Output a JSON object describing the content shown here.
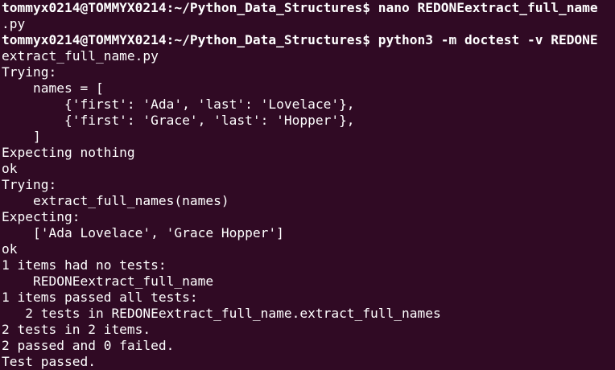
{
  "terminal": {
    "lines": [
      {
        "kind": "prompt",
        "text": "tommyx0214@TOMMYX0214:~/Python_Data_Structures$ nano REDONEextract_full_name"
      },
      {
        "kind": "output",
        "text": ".py"
      },
      {
        "kind": "prompt",
        "text": "tommyx0214@TOMMYX0214:~/Python_Data_Structures$ python3 -m doctest -v REDONE"
      },
      {
        "kind": "output",
        "text": "extract_full_name.py"
      },
      {
        "kind": "output",
        "text": "Trying:"
      },
      {
        "kind": "output",
        "text": "    names = ["
      },
      {
        "kind": "output",
        "text": "        {'first': 'Ada', 'last': 'Lovelace'},"
      },
      {
        "kind": "output",
        "text": "        {'first': 'Grace', 'last': 'Hopper'},"
      },
      {
        "kind": "output",
        "text": "    ]"
      },
      {
        "kind": "output",
        "text": "Expecting nothing"
      },
      {
        "kind": "output",
        "text": "ok"
      },
      {
        "kind": "output",
        "text": "Trying:"
      },
      {
        "kind": "output",
        "text": "    extract_full_names(names)"
      },
      {
        "kind": "output",
        "text": "Expecting:"
      },
      {
        "kind": "output",
        "text": "    ['Ada Lovelace', 'Grace Hopper']"
      },
      {
        "kind": "output",
        "text": "ok"
      },
      {
        "kind": "output",
        "text": "1 items had no tests:"
      },
      {
        "kind": "output",
        "text": "    REDONEextract_full_name"
      },
      {
        "kind": "output",
        "text": "1 items passed all tests:"
      },
      {
        "kind": "output",
        "text": "   2 tests in REDONEextract_full_name.extract_full_names"
      },
      {
        "kind": "output",
        "text": "2 tests in 2 items."
      },
      {
        "kind": "output",
        "text": "2 passed and 0 failed."
      },
      {
        "kind": "output",
        "text": "Test passed."
      }
    ]
  },
  "colors": {
    "background": "#300a24",
    "foreground": "#ffffff"
  }
}
